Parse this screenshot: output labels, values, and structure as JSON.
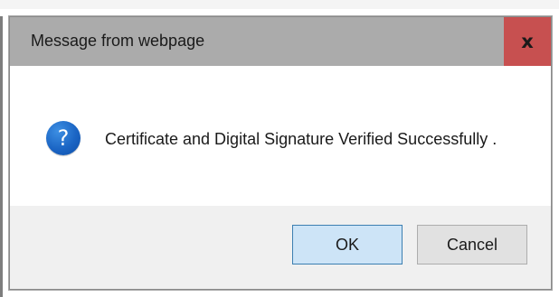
{
  "dialog": {
    "title": "Message from webpage",
    "close_label": "x",
    "message": "Certificate and Digital Signature Verified Successfully .",
    "icon": "question-icon",
    "icon_glyph": "?",
    "buttons": {
      "ok_label": "OK",
      "cancel_label": "Cancel"
    }
  },
  "colors": {
    "titlebar": "#ababab",
    "close_button": "#c75050",
    "ok_button": "#cde4f7",
    "ok_border": "#3c7fb1",
    "icon_blue": "#1b65c4",
    "footer": "#f0f0f0"
  }
}
